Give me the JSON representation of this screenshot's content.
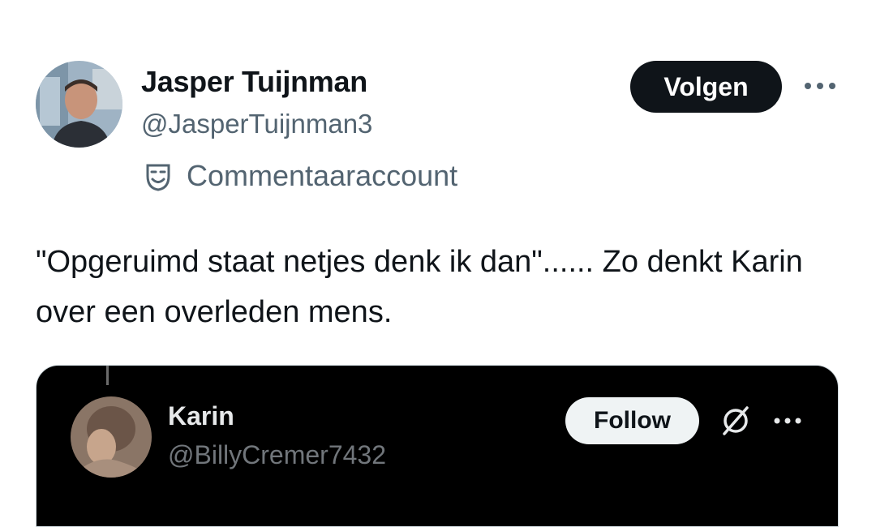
{
  "post": {
    "author": {
      "name": "Jasper Tuijnman",
      "handle": "@JasperTuijnman3",
      "badge_label": "Commentaaraccount",
      "avatar_icon": "profile-photo"
    },
    "follow_label": "Volgen",
    "more_icon": "more-horizontal-icon",
    "text": "\"Opgeruimd staat netjes denk ik dan\"...... Zo denkt Karin over een overleden mens."
  },
  "quoted": {
    "author": {
      "name": "Karin",
      "handle": "@BillyCremer7432",
      "avatar_icon": "profile-photo"
    },
    "follow_label": "Follow",
    "slash_icon": "circle-slash-icon",
    "more_icon": "more-horizontal-icon"
  },
  "colors": {
    "primary_text": "#0f1419",
    "secondary_text": "#536471",
    "quote_background": "#000000",
    "quote_name": "#e7e9ea",
    "quote_handle": "#71767b"
  }
}
